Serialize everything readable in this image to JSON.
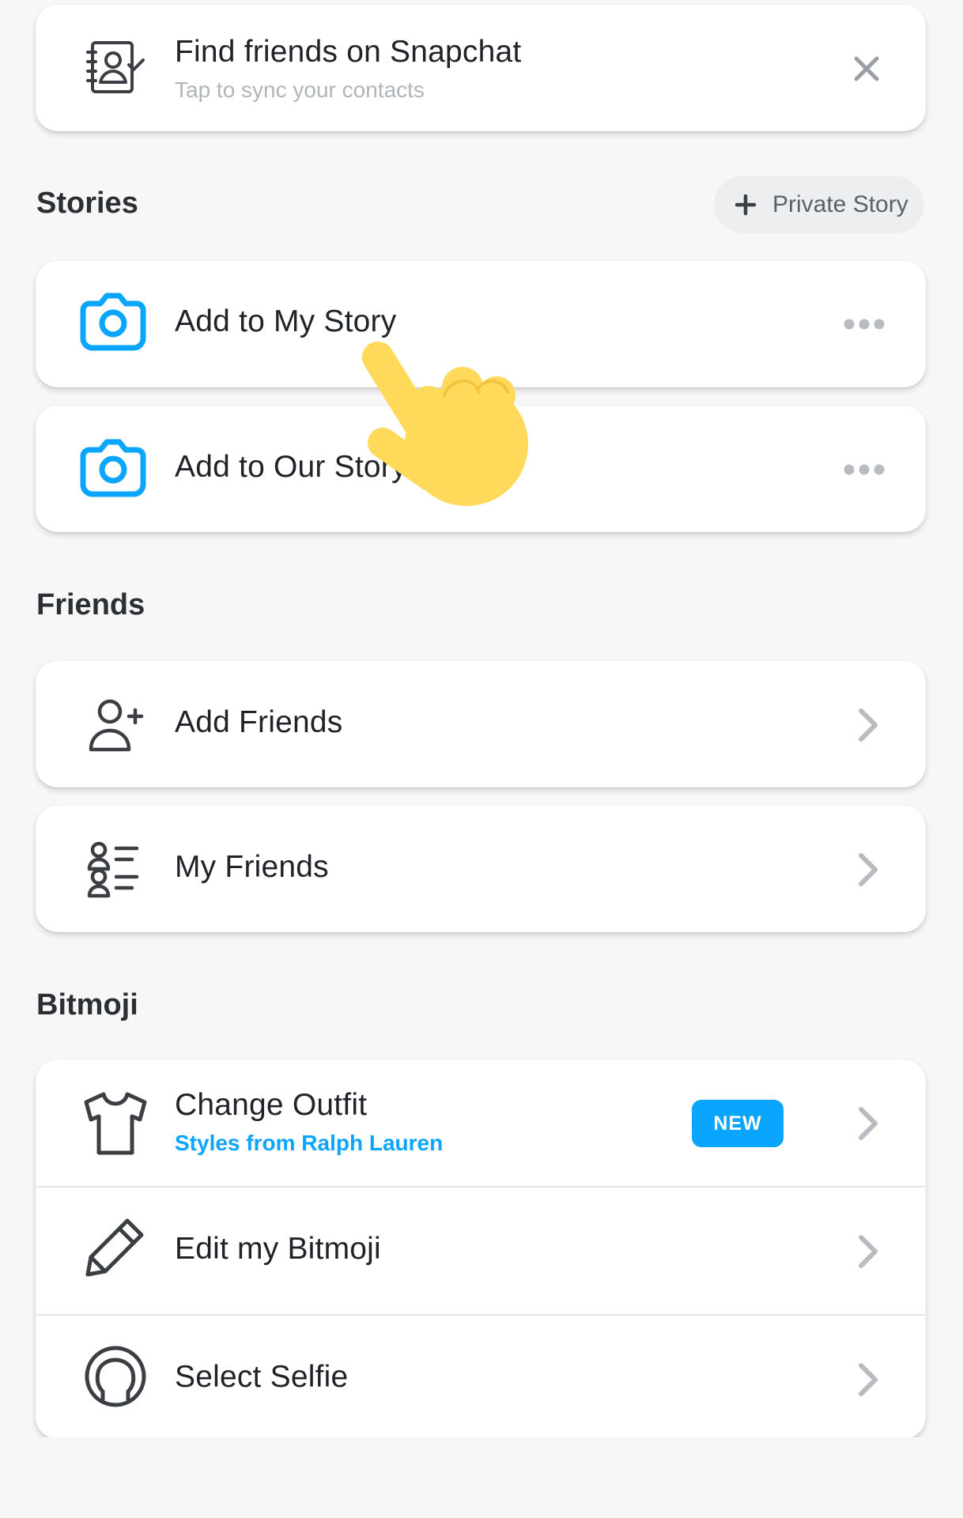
{
  "find_friends": {
    "title": "Find friends on Snapchat",
    "subtitle": "Tap to sync your contacts",
    "icon": "contacts-sync-icon",
    "close_icon": "close-icon"
  },
  "stories": {
    "section_title": "Stories",
    "private_story_button": "Private Story",
    "items": [
      {
        "label": "Add to My Story",
        "icon": "camera-icon"
      },
      {
        "label": "Add to Our Story",
        "icon": "camera-icon"
      }
    ]
  },
  "friends": {
    "section_title": "Friends",
    "items": [
      {
        "label": "Add Friends",
        "icon": "add-friend-icon"
      },
      {
        "label": "My Friends",
        "icon": "friends-list-icon"
      }
    ]
  },
  "bitmoji": {
    "section_title": "Bitmoji",
    "items": [
      {
        "label": "Change Outfit",
        "subtitle": "Styles from Ralph Lauren",
        "badge": "NEW",
        "icon": "shirt-icon"
      },
      {
        "label": "Edit my Bitmoji",
        "icon": "pencil-icon"
      },
      {
        "label": "Select Selfie",
        "icon": "selfie-icon"
      }
    ]
  },
  "colors": {
    "accent_blue": "#0aa5ff",
    "subtitle_gray": "#b0b5ba",
    "hand_yellow": "#ffd95a",
    "background": "#f7f7f7"
  }
}
